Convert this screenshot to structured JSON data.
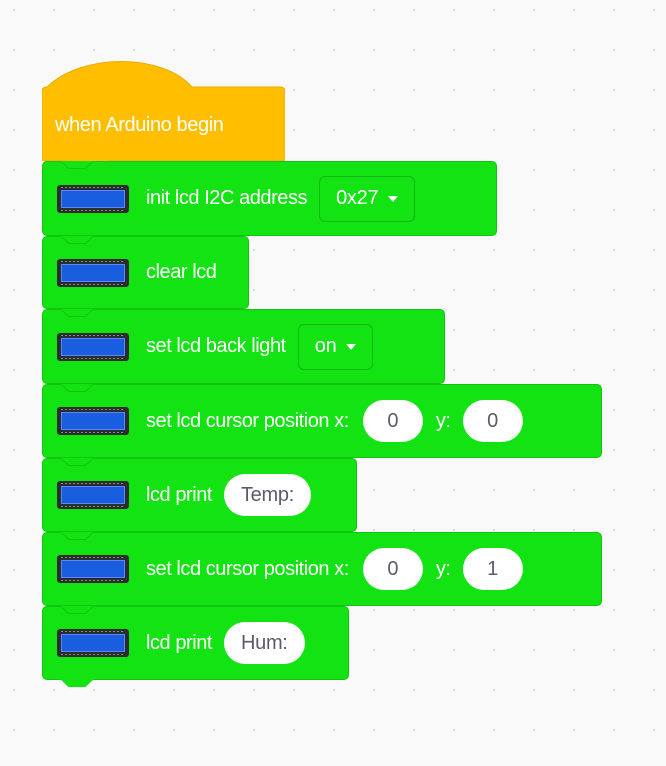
{
  "hat": {
    "label": "when Arduino begin",
    "color": "#ffbf00"
  },
  "block_color": "#13e213",
  "blocks": [
    {
      "icon": "lcd-display-icon",
      "label": "init lcd I2C address",
      "dropdown": "0x27"
    },
    {
      "icon": "lcd-display-icon",
      "label": "clear lcd"
    },
    {
      "icon": "lcd-display-icon",
      "label": "set lcd back light",
      "dropdown": "on"
    },
    {
      "icon": "lcd-display-icon",
      "label": "set lcd cursor position x:",
      "x": "0",
      "y_label": "y:",
      "y": "0"
    },
    {
      "icon": "lcd-display-icon",
      "label": "lcd print",
      "text": "Temp:"
    },
    {
      "icon": "lcd-display-icon",
      "label": "set lcd cursor position x:",
      "x": "0",
      "y_label": "y:",
      "y": "1"
    },
    {
      "icon": "lcd-display-icon",
      "label": "lcd print",
      "text": "Hum:"
    }
  ]
}
